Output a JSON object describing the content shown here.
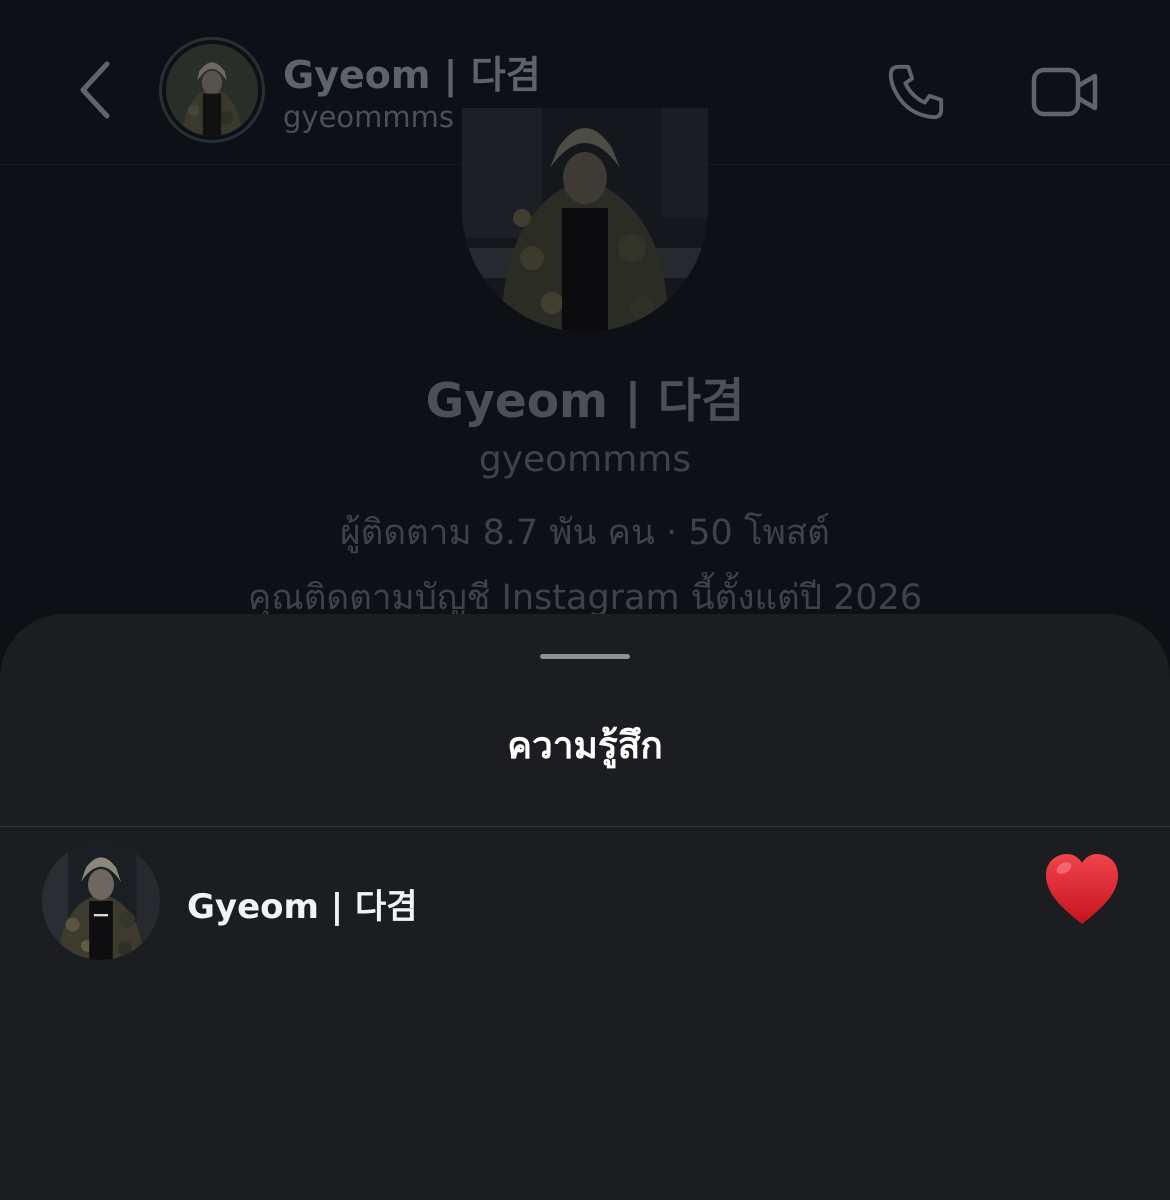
{
  "header": {
    "back_icon": "chevron-left-icon",
    "display_name": "Gyeom | 다겸",
    "username": "gyeommms",
    "call_icon": "phone-icon",
    "video_icon": "video-camera-icon"
  },
  "profile": {
    "display_name": "Gyeom | 다겸",
    "username": "gyeommms",
    "stats": "ผู้ติดตาม 8.7 พัน คน · 50 โพสต์",
    "follow_since": "คุณติดตามบัญชี Instagram นี้ตั้งแต่ปี 2026"
  },
  "sheet": {
    "title": "ความรู้สึก",
    "reactions": [
      {
        "name": "Gyeom | 다겸",
        "emoji": "red-heart-icon"
      }
    ]
  },
  "colors": {
    "background": "#0d1116",
    "sheet": "#1b1d21",
    "heart": "#e0242f",
    "dim_text": "#4b5058"
  }
}
